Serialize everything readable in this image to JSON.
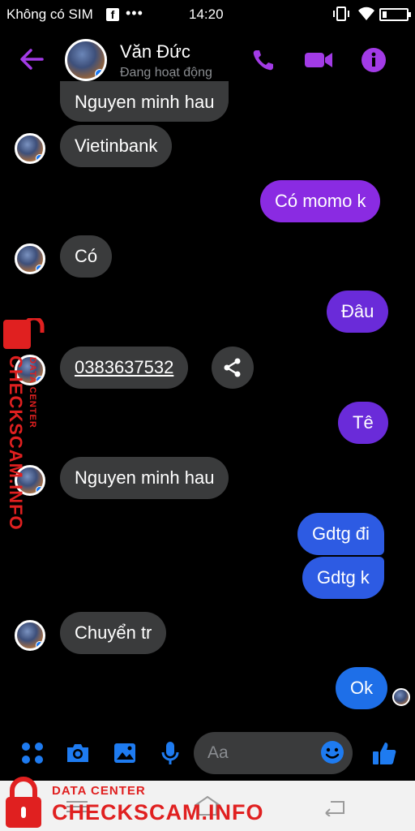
{
  "status_bar": {
    "carrier": "Không có SIM",
    "fb_glyph": "f",
    "time": "14:20"
  },
  "header": {
    "name": "Văn Đức",
    "status": "Đang hoạt động"
  },
  "messages": [
    {
      "side": "in",
      "text": "Nguyen minh hau"
    },
    {
      "side": "in",
      "text": "Vietinbank"
    },
    {
      "side": "out",
      "text": "Có momo k"
    },
    {
      "side": "in",
      "text": "Có"
    },
    {
      "side": "out",
      "text": "Đâu"
    },
    {
      "side": "in",
      "text": "0383637532",
      "link": true
    },
    {
      "side": "out",
      "text": "Tê"
    },
    {
      "side": "in",
      "text": "Nguyen minh hau"
    },
    {
      "side": "out",
      "text": "Gdtg đi"
    },
    {
      "side": "out",
      "text": "Gdtg k"
    },
    {
      "side": "in",
      "text": "Chuyển tr"
    },
    {
      "side": "out",
      "text": "Ok"
    }
  ],
  "composer": {
    "placeholder": "Aa"
  },
  "watermark": {
    "brand": "CHECKSCAM.INFO",
    "tag": "DATA CENTER"
  },
  "colors": {
    "accent": "#a23be6",
    "blue": "#1e6fe8",
    "incoming": "#3a3b3c",
    "watermark": "#e02020"
  }
}
